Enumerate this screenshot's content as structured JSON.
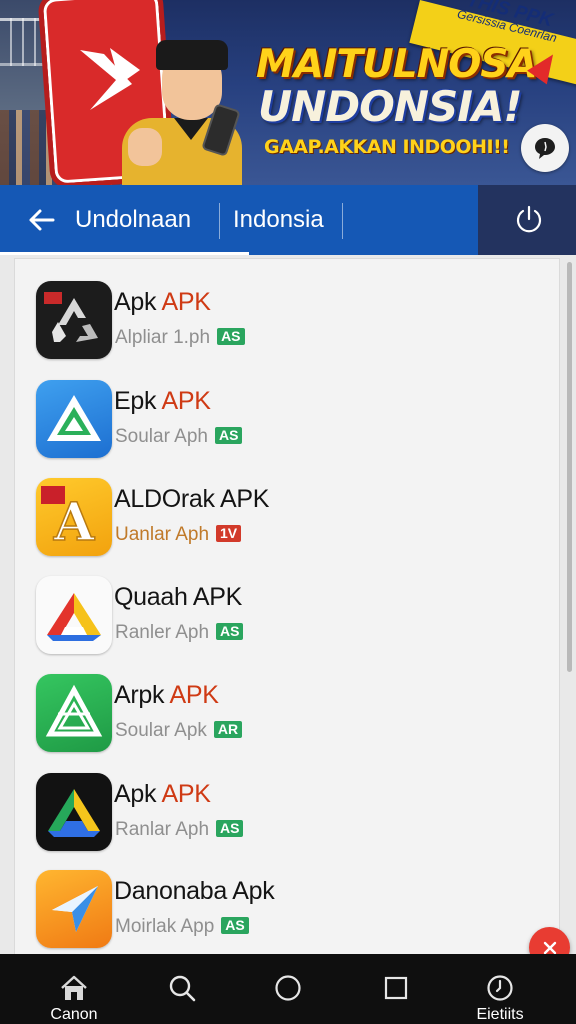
{
  "banner": {
    "title_line1": "MAITULNOSA",
    "title_line2": "UNDONSIA!",
    "slogan": "GAAP.AKKAN INDOOHI!!",
    "ribbon_main": "THIS PPK",
    "ribbon_sub": "Gersissia Coenrlan"
  },
  "appbar": {
    "tab_active": "Undolnaan",
    "tab_second": "Indonsia"
  },
  "apps": [
    {
      "name": "Apk",
      "apk_suffix": "APK",
      "sub": "Alpliar 1.ph",
      "badge": "AS",
      "badge_color": "#2aa55e",
      "icon": "recycle-icon"
    },
    {
      "name": "Epk",
      "apk_suffix": "APK",
      "sub": "Soular Aph",
      "badge": "AS",
      "badge_color": "#2aa55e",
      "icon": "triangle-a-icon"
    },
    {
      "name": "ALDOrak APK",
      "apk_suffix": "",
      "sub": "Uanlar Aph",
      "badge": "1V",
      "badge_color": "#d23a2a",
      "icon": "letter-a-icon"
    },
    {
      "name": "Quaah APK",
      "apk_suffix": "",
      "sub": "Ranler Aph",
      "badge": "AS",
      "badge_color": "#2aa55e",
      "icon": "drive-triangle-icon"
    },
    {
      "name": "Arpk",
      "apk_suffix": "APK",
      "sub": "Soular Apk",
      "badge": "AR",
      "badge_color": "#2aa55e",
      "icon": "green-a-icon"
    },
    {
      "name": "Apk",
      "apk_suffix": "APK",
      "sub": "Ranlar Aph",
      "badge": "AS",
      "badge_color": "#2aa55e",
      "icon": "drive-dark-icon"
    },
    {
      "name": "Danonaba Apk",
      "apk_suffix": "",
      "sub": "Moirlak App",
      "badge": "AS",
      "badge_color": "#2aa55e",
      "icon": "paper-plane-icon"
    }
  ],
  "nav": {
    "home_label": "Canon",
    "last_label": "Eietiits"
  },
  "colors": {
    "appbar": "#1558b5",
    "appbar_dark": "#23335f",
    "apk_text": "#cf3a14",
    "badge_green": "#2aa55e",
    "badge_red": "#d23a2a",
    "fab": "#e83c32"
  }
}
